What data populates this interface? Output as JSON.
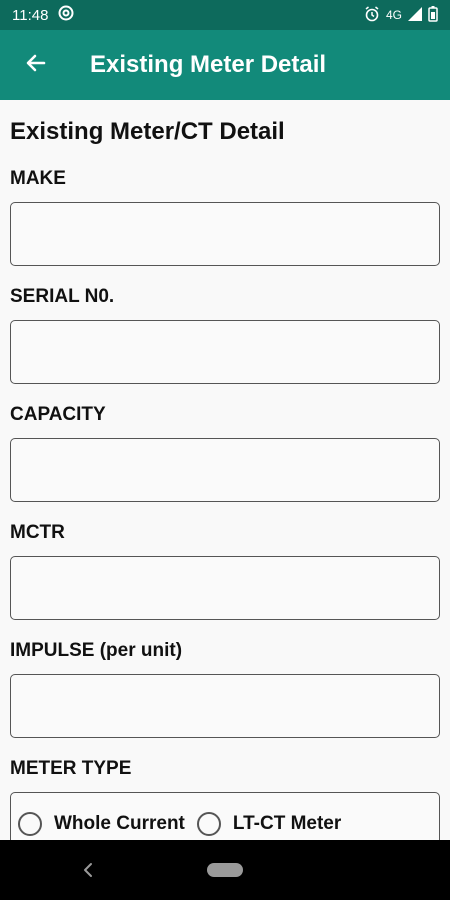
{
  "status_bar": {
    "time": "11:48",
    "network": "4G"
  },
  "app_bar": {
    "title": "Existing Meter Detail",
    "back_icon": "arrow-left-icon"
  },
  "form": {
    "section_title": "Existing Meter/CT Detail",
    "fields": [
      {
        "label": "MAKE",
        "value": ""
      },
      {
        "label": "SERIAL N0.",
        "value": ""
      },
      {
        "label": "CAPACITY",
        "value": ""
      },
      {
        "label": "MCTR",
        "value": ""
      },
      {
        "label": "IMPULSE (per unit)",
        "value": ""
      }
    ],
    "meter_type": {
      "label": "METER TYPE",
      "options": [
        "Whole Current",
        "LT-CT Meter"
      ],
      "selected": ""
    }
  },
  "colors": {
    "status_bar": "#0d6a5c",
    "app_bar": "#128a7a",
    "background": "#f9f9f9",
    "nav_bar": "#000000"
  }
}
